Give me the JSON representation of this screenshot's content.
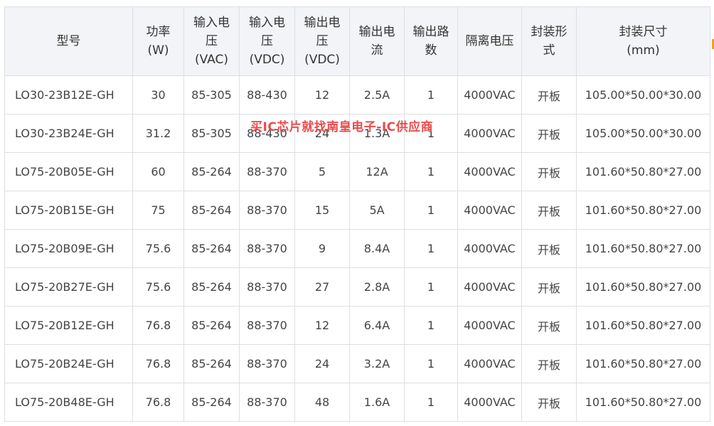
{
  "table": {
    "headers": [
      "型号",
      "功率\n(W)",
      "输入电\n压\n(VAC)",
      "输入电\n压\n(VDC)",
      "输出电\n压\n(VDC)",
      "输出电\n流",
      "输出路\n数",
      "隔离电压",
      "封装形\n式",
      "封装尺寸\n(mm)"
    ],
    "rows": [
      [
        "LO30-23B12E-GH",
        "30",
        "85-305",
        "88-430",
        "12",
        "2.5A",
        "1",
        "4000VAC",
        "开板",
        "105.00*50.00*30.00"
      ],
      [
        "LO30-23B24E-GH",
        "31.2",
        "85-305",
        "88-430",
        "24",
        "1.3A",
        "1",
        "4000VAC",
        "开板",
        "105.00*50.00*30.00"
      ],
      [
        "LO75-20B05E-GH",
        "60",
        "85-264",
        "88-370",
        "5",
        "12A",
        "1",
        "4000VAC",
        "开板",
        "101.60*50.80*27.00"
      ],
      [
        "LO75-20B15E-GH",
        "75",
        "85-264",
        "88-370",
        "15",
        "5A",
        "1",
        "4000VAC",
        "开板",
        "101.60*50.80*27.00"
      ],
      [
        "LO75-20B09E-GH",
        "75.6",
        "85-264",
        "88-370",
        "9",
        "8.4A",
        "1",
        "4000VAC",
        "开板",
        "101.60*50.80*27.00"
      ],
      [
        "LO75-20B27E-GH",
        "75.6",
        "85-264",
        "88-370",
        "27",
        "2.8A",
        "1",
        "4000VAC",
        "开板",
        "101.60*50.80*27.00"
      ],
      [
        "LO75-20B12E-GH",
        "76.8",
        "85-264",
        "88-370",
        "12",
        "6.4A",
        "1",
        "4000VAC",
        "开板",
        "101.60*50.80*27.00"
      ],
      [
        "LO75-20B24E-GH",
        "76.8",
        "85-264",
        "88-370",
        "24",
        "3.2A",
        "1",
        "4000VAC",
        "开板",
        "101.60*50.80*27.00"
      ],
      [
        "LO75-20B48E-GH",
        "76.8",
        "85-264",
        "88-370",
        "48",
        "1.6A",
        "1",
        "4000VAC",
        "开板",
        "101.60*50.80*27.00"
      ]
    ]
  },
  "watermark": {
    "text": "买IC芯片就找南皇电子-IC供应商"
  },
  "colors": {
    "header_bg": "#f2f4f7",
    "border": "#dcdfe4",
    "watermark": "#ec4b4b",
    "edge_accent": "#f0a020"
  }
}
